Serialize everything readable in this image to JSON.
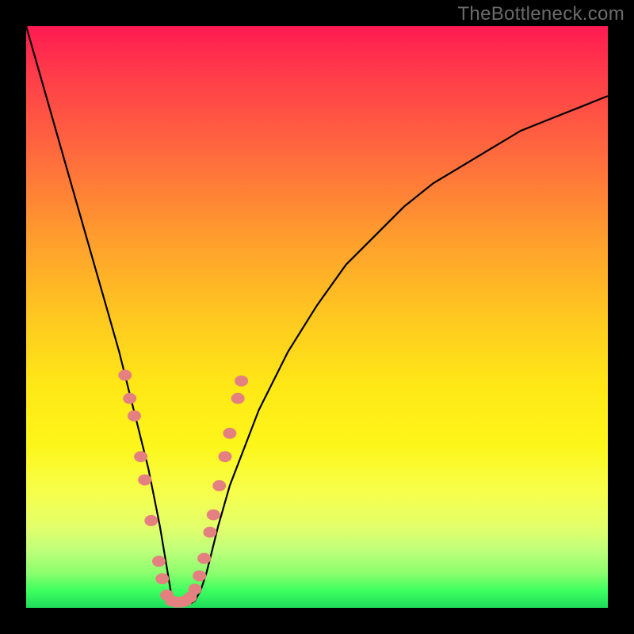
{
  "watermark": "TheBottleneck.com",
  "colors": {
    "frame": "#000000",
    "curve": "#000000",
    "dot": "#e58080"
  },
  "chart_data": {
    "type": "line",
    "title": "",
    "xlabel": "",
    "ylabel": "",
    "xlim": [
      0,
      100
    ],
    "ylim": [
      0,
      100
    ],
    "grid": false,
    "legend": false,
    "note": "Axes are unlabeled; x/y normalized 0–100 (left/bottom origin). Curve is a V-shaped bottleneck with minimum ~x=25, y≈0. Dots mark a cluster near the vertex.",
    "series": [
      {
        "name": "bottleneck-curve",
        "x": [
          0,
          2,
          4,
          6,
          8,
          10,
          12,
          14,
          16,
          18,
          19,
          20,
          21,
          22,
          23,
          24,
          25,
          26,
          27,
          28,
          29,
          30,
          31,
          32,
          33,
          35,
          40,
          45,
          50,
          55,
          60,
          65,
          70,
          75,
          80,
          85,
          90,
          95,
          100
        ],
        "y": [
          100,
          93,
          86,
          79,
          72,
          65,
          58,
          51,
          44,
          36,
          32,
          28,
          24,
          19,
          14,
          8,
          2,
          0.5,
          0.4,
          0.6,
          1.2,
          3,
          6,
          10,
          14,
          21,
          34,
          44,
          52,
          59,
          64,
          69,
          73,
          76,
          79,
          82,
          84,
          86,
          88
        ]
      }
    ],
    "dots": {
      "name": "highlighted-points",
      "points": [
        {
          "x": 17.0,
          "y": 40
        },
        {
          "x": 17.8,
          "y": 36
        },
        {
          "x": 18.6,
          "y": 33
        },
        {
          "x": 19.7,
          "y": 26
        },
        {
          "x": 20.4,
          "y": 22
        },
        {
          "x": 21.5,
          "y": 15
        },
        {
          "x": 22.8,
          "y": 8
        },
        {
          "x": 23.4,
          "y": 5
        },
        {
          "x": 24.2,
          "y": 2.2
        },
        {
          "x": 25.0,
          "y": 1.2
        },
        {
          "x": 25.8,
          "y": 1.0
        },
        {
          "x": 26.6,
          "y": 1.0
        },
        {
          "x": 27.4,
          "y": 1.2
        },
        {
          "x": 28.2,
          "y": 1.8
        },
        {
          "x": 29.0,
          "y": 3.2
        },
        {
          "x": 29.8,
          "y": 5.5
        },
        {
          "x": 30.6,
          "y": 8.5
        },
        {
          "x": 31.6,
          "y": 13
        },
        {
          "x": 32.2,
          "y": 16
        },
        {
          "x": 33.2,
          "y": 21
        },
        {
          "x": 34.2,
          "y": 26
        },
        {
          "x": 35.0,
          "y": 30
        },
        {
          "x": 36.4,
          "y": 36
        },
        {
          "x": 37.0,
          "y": 39
        }
      ]
    }
  }
}
